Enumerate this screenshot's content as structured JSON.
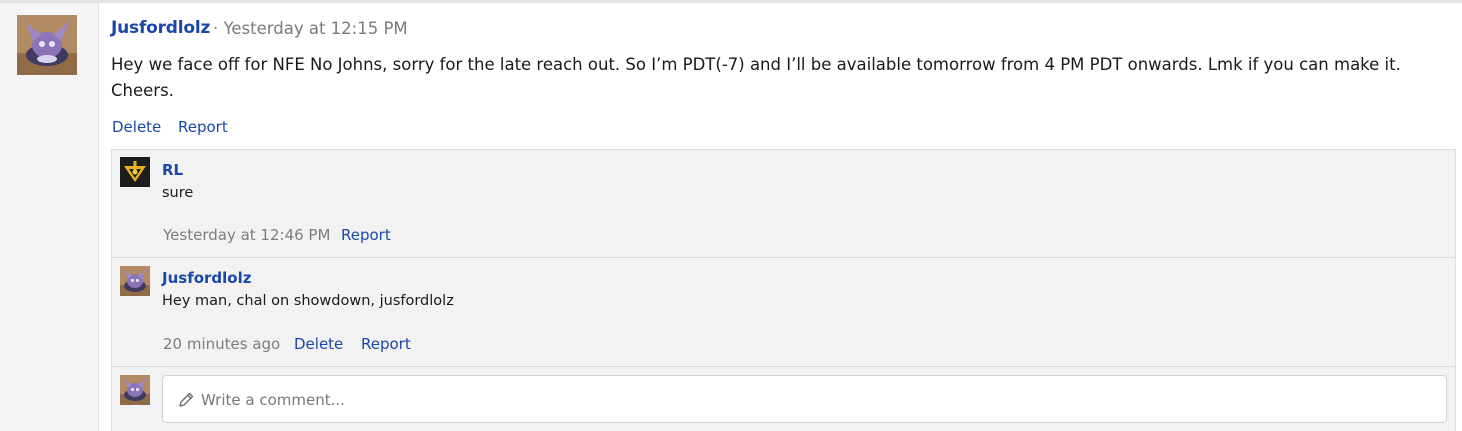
{
  "post": {
    "author": "Jusfordlolz",
    "time": "· Yesterday at 12:15 PM",
    "body": "Hey we face off for NFE No Johns, sorry for the late reach out. So I’m PDT(-7) and I’ll be available tomorrow from 4 PM PDT onwards. Lmk if you can make it. Cheers.",
    "actions": {
      "delete": "Delete",
      "report": "Report"
    }
  },
  "replies": [
    {
      "author": "RL",
      "body": "sure",
      "time": "Yesterday at 12:46 PM",
      "actions": {
        "report": "Report"
      }
    },
    {
      "author": "Jusfordlolz",
      "body": "Hey man, chal on showdown, jusfordlolz",
      "time": "20 minutes ago",
      "actions": {
        "delete": "Delete",
        "report": "Report"
      }
    }
  ],
  "comment_box": {
    "placeholder": "Write a comment..."
  },
  "colors": {
    "link": "#1a48a8",
    "meta": "#7d7d7d",
    "reply_bg": "#f2f2f2"
  },
  "icons": {
    "pencil": "pencil-icon"
  }
}
